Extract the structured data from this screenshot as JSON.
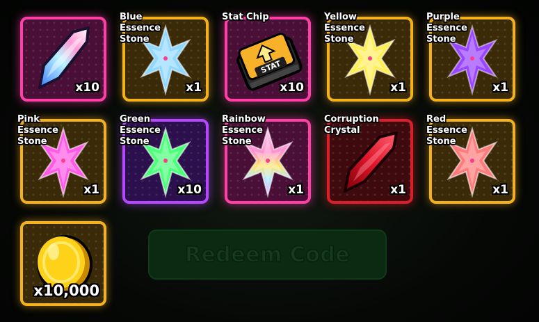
{
  "redeem": {
    "label": "Redeem Code"
  },
  "items": [
    {
      "label": "",
      "qty": "x10",
      "icon": "crystal-shard-icon",
      "color": "#6fc3ff"
    },
    {
      "label": "Blue\nEssence\nStone",
      "qty": "x1",
      "icon": "essence-stone-icon",
      "color": "#8fd8ff"
    },
    {
      "label": "Stat Chip",
      "qty": "x10",
      "icon": "stat-chip-icon",
      "color": "#f7b22a"
    },
    {
      "label": "Yellow\nEssence\nStone",
      "qty": "x1",
      "icon": "essence-stone-icon",
      "color": "#ffee55"
    },
    {
      "label": "Purple\nEssence\nStone",
      "qty": "x1",
      "icon": "essence-stone-icon",
      "color": "#9a45ff"
    },
    {
      "label": "Pink\nEssence\nStone",
      "qty": "x1",
      "icon": "essence-stone-icon",
      "color": "#ff5ae6"
    },
    {
      "label": "Green\nEssence\nStone",
      "qty": "x10",
      "icon": "essence-stone-icon",
      "color": "#4cff7a"
    },
    {
      "label": "Rainbow\nEssence\nStone",
      "qty": "x1",
      "icon": "essence-stone-icon",
      "color": "#ffb3e8"
    },
    {
      "label": "Corruption\nCrystal",
      "qty": "x1",
      "icon": "crystal-shard-icon",
      "color": "#d01020"
    },
    {
      "label": "Red\nEssence\nStone",
      "qty": "x1",
      "icon": "essence-stone-icon",
      "color": "#ff7b7b"
    },
    {
      "label": "",
      "qty": "x10,000",
      "icon": "gold-coin-icon",
      "color": "#ffd21a"
    }
  ]
}
